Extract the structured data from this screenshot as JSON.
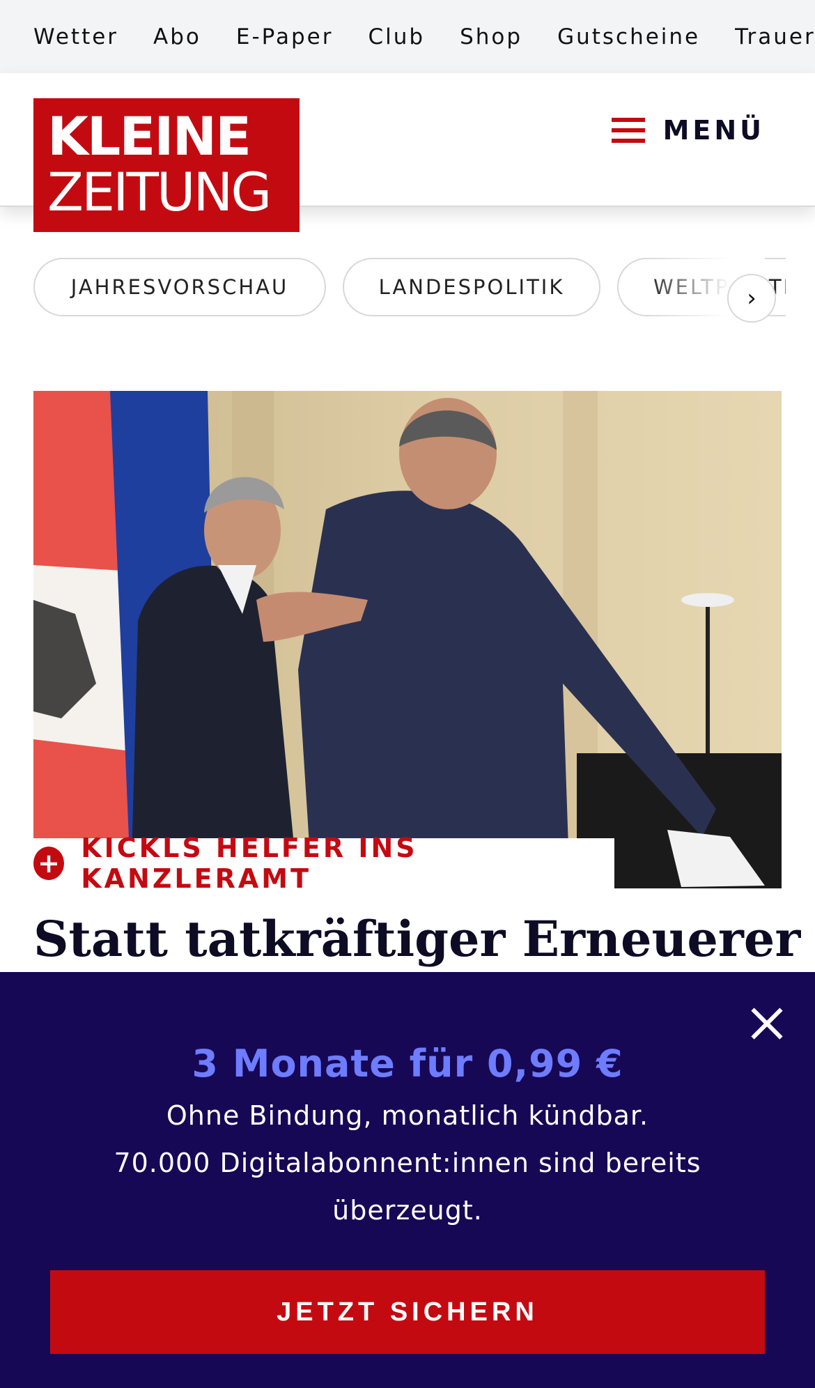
{
  "topnav": {
    "items": [
      "Wetter",
      "Abo",
      "E-Paper",
      "Club",
      "Shop",
      "Gutscheine",
      "Trauerportal"
    ]
  },
  "header": {
    "logo_line1": "KLEINE",
    "logo_line2": "ZEITUNG",
    "menu_label": "MENÜ"
  },
  "topics": {
    "chips": [
      "JAHRESVORSCHAU",
      "LANDESPOLITIK",
      "WELTPOLITIK"
    ]
  },
  "article": {
    "kicker": "KICKLS HELFER INS KANZLERAMT",
    "headline": "Statt tatkräftiger Erneuerer"
  },
  "paywall": {
    "title": "3 Monate für 0,99 €",
    "subtitle": "Ohne Bindung, monatlich kündbar.",
    "claim": "70.000 Digitalabonnent:innen sind bereits überzeugt.",
    "cta_label": "JETZT SICHERN"
  },
  "colors": {
    "brand_red": "#c40a11",
    "overlay_bg": "#170855",
    "offer_accent": "#6e7cff"
  },
  "icons": {
    "menu": "hamburger-icon",
    "kicker": "plus-icon",
    "chip_next": "chevron-right-icon",
    "close": "close-icon"
  }
}
